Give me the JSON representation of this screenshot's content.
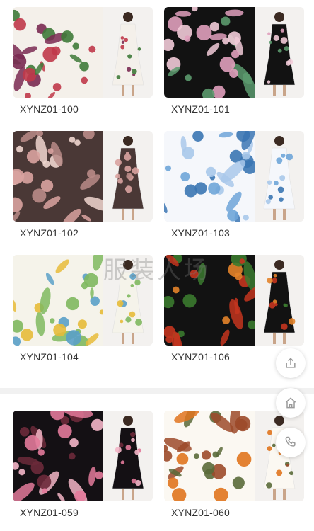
{
  "watermark": "服装人场",
  "products": [
    {
      "code": "XYNZ01-100",
      "pattern": "white floral rose print",
      "colors": [
        "#f4f0ea",
        "#c0394a",
        "#7a2a52",
        "#3f7a3a"
      ]
    },
    {
      "code": "XYNZ01-101",
      "pattern": "black tropical pink protea print",
      "colors": [
        "#121212",
        "#e0a0bd",
        "#5c9a6e",
        "#f2cbd8"
      ]
    },
    {
      "code": "XYNZ01-102",
      "pattern": "brown palm leaf print",
      "colors": [
        "#4a3836",
        "#d9a3a0",
        "#b98b87",
        "#f0d6cf"
      ]
    },
    {
      "code": "XYNZ01-103",
      "pattern": "blue palm leaf on white",
      "colors": [
        "#f5f7fb",
        "#6fa5d8",
        "#a9c8ea",
        "#3b76b3"
      ]
    },
    {
      "code": "XYNZ01-104",
      "pattern": "yellow green leaf print",
      "colors": [
        "#f5f3ea",
        "#e7bb3a",
        "#7fb85f",
        "#5aa0c8"
      ]
    },
    {
      "code": "XYNZ01-106",
      "pattern": "black orange papaya print",
      "colors": [
        "#121212",
        "#e3832a",
        "#c4351f",
        "#3b7a2f"
      ]
    },
    {
      "code": "XYNZ01-059",
      "pattern": "black pink floral print",
      "colors": [
        "#141014",
        "#e27a9a",
        "#f3b5c6",
        "#6b2a3a"
      ]
    },
    {
      "code": "XYNZ01-060",
      "pattern": "white orange floral print",
      "colors": [
        "#fbf8f2",
        "#e0741e",
        "#9c4a2a",
        "#5a6a3a"
      ]
    }
  ],
  "fabs": [
    {
      "icon": "share-icon"
    },
    {
      "icon": "home-icon"
    },
    {
      "icon": "phone-icon"
    }
  ]
}
